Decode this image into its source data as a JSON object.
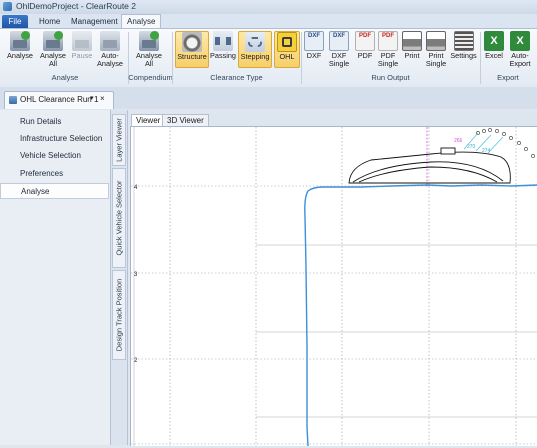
{
  "window": {
    "title": "OhlDemoProject - ClearRoute 2"
  },
  "ribbon_tabs": {
    "file": "File",
    "home": "Home",
    "management": "Management",
    "analyse": "Analyse"
  },
  "ribbon": {
    "analyse_group": {
      "label": "Analyse",
      "analyse": "Analyse",
      "analyse_all": "Analyse All",
      "pause": "Pause",
      "auto_analyse": "Auto-Analyse"
    },
    "compendium_group": {
      "label": "Compendium",
      "analyse_all": "Analyse All"
    },
    "clearance_group": {
      "label": "Clearance Type",
      "structure": "Structure",
      "passing": "Passing",
      "stepping": "Stepping",
      "ohl": "OHL"
    },
    "run_output_group": {
      "label": "Run Output",
      "dxf": "DXF",
      "dxf_single": "DXF Single",
      "pdf": "PDF",
      "pdf_single": "PDF Single",
      "print": "Print",
      "print_single": "Print Single",
      "settings": "Settings"
    },
    "export_group": {
      "label": "Export",
      "excel": "Excel",
      "auto_export": "Auto-Export"
    }
  },
  "icon_text": {
    "dxf": "DXF",
    "pdf": "PDF",
    "excel": "X"
  },
  "document_tab": {
    "label": "OHL Clearance Run 1",
    "pin": "▾",
    "close": "×"
  },
  "left_nav": {
    "items": [
      {
        "label": "Run Details"
      },
      {
        "label": "Infrastructure Selection"
      },
      {
        "label": "Vehicle Selection"
      },
      {
        "label": "Preferences"
      },
      {
        "label": "Analyse"
      }
    ]
  },
  "side_tabs": {
    "layer_viewer": "Layer Viewer",
    "quick_vehicle_selector": "Quick Vehicle Selector",
    "design_track_position": "Design Track Position"
  },
  "viewer": {
    "tabs": {
      "viewer": "Viewer",
      "view_3d": "3D Viewer"
    },
    "y_labels": {
      "y4": "4",
      "y3": "3",
      "y2": "2"
    },
    "annotations": {
      "a1": "266",
      "a2": "270",
      "a3": "274"
    }
  },
  "colors": {
    "wire": "#3d8fd8",
    "accent": "#1f57a6",
    "selection": "#f7cf6b"
  }
}
